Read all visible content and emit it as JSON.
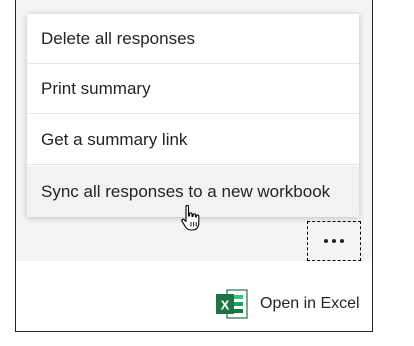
{
  "menu": {
    "items": [
      {
        "label": "Delete all responses"
      },
      {
        "label": "Print summary"
      },
      {
        "label": "Get a summary link"
      },
      {
        "label": "Sync all responses to a new workbook"
      }
    ]
  },
  "more_button": {
    "icon": "ellipsis-icon"
  },
  "excel": {
    "icon_letter": "X",
    "open_label": "Open in Excel"
  },
  "colors": {
    "excel_green": "#217346",
    "hover_bg": "#f3f2f1"
  }
}
